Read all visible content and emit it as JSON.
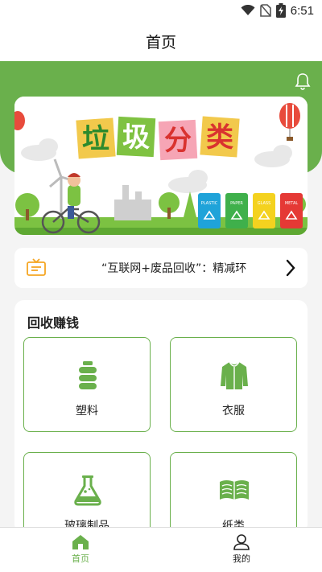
{
  "status_bar": {
    "time": "6:51",
    "icons": [
      "wifi-icon",
      "no-sim-icon",
      "battery-charging-icon"
    ]
  },
  "header": {
    "title": "首页"
  },
  "banner": {
    "title_chars": [
      "垃",
      "圾",
      "分",
      "类"
    ],
    "bin_labels": [
      "PLASTIC",
      "PAPER",
      "GLASS",
      "METAL"
    ]
  },
  "notice": {
    "icon": "notice-board-icon",
    "text": "“互联网+废品回收”：精减环",
    "chevron": "chevron-right-icon"
  },
  "recycle": {
    "title": "回收赚钱",
    "categories": [
      {
        "label": "塑料",
        "icon": "plastic-bottle-icon"
      },
      {
        "label": "衣服",
        "icon": "jacket-icon"
      },
      {
        "label": "玻璃制品",
        "icon": "flask-icon"
      },
      {
        "label": "纸类",
        "icon": "paper-stack-icon"
      }
    ]
  },
  "tabbar": {
    "tabs": [
      {
        "label": "首页",
        "icon": "home-icon",
        "active": true
      },
      {
        "label": "我的",
        "icon": "user-icon",
        "active": false
      }
    ]
  },
  "colors": {
    "brand_green": "#6ab04c",
    "active_tab": "#6ab04c",
    "inactive_tab": "#222222"
  }
}
